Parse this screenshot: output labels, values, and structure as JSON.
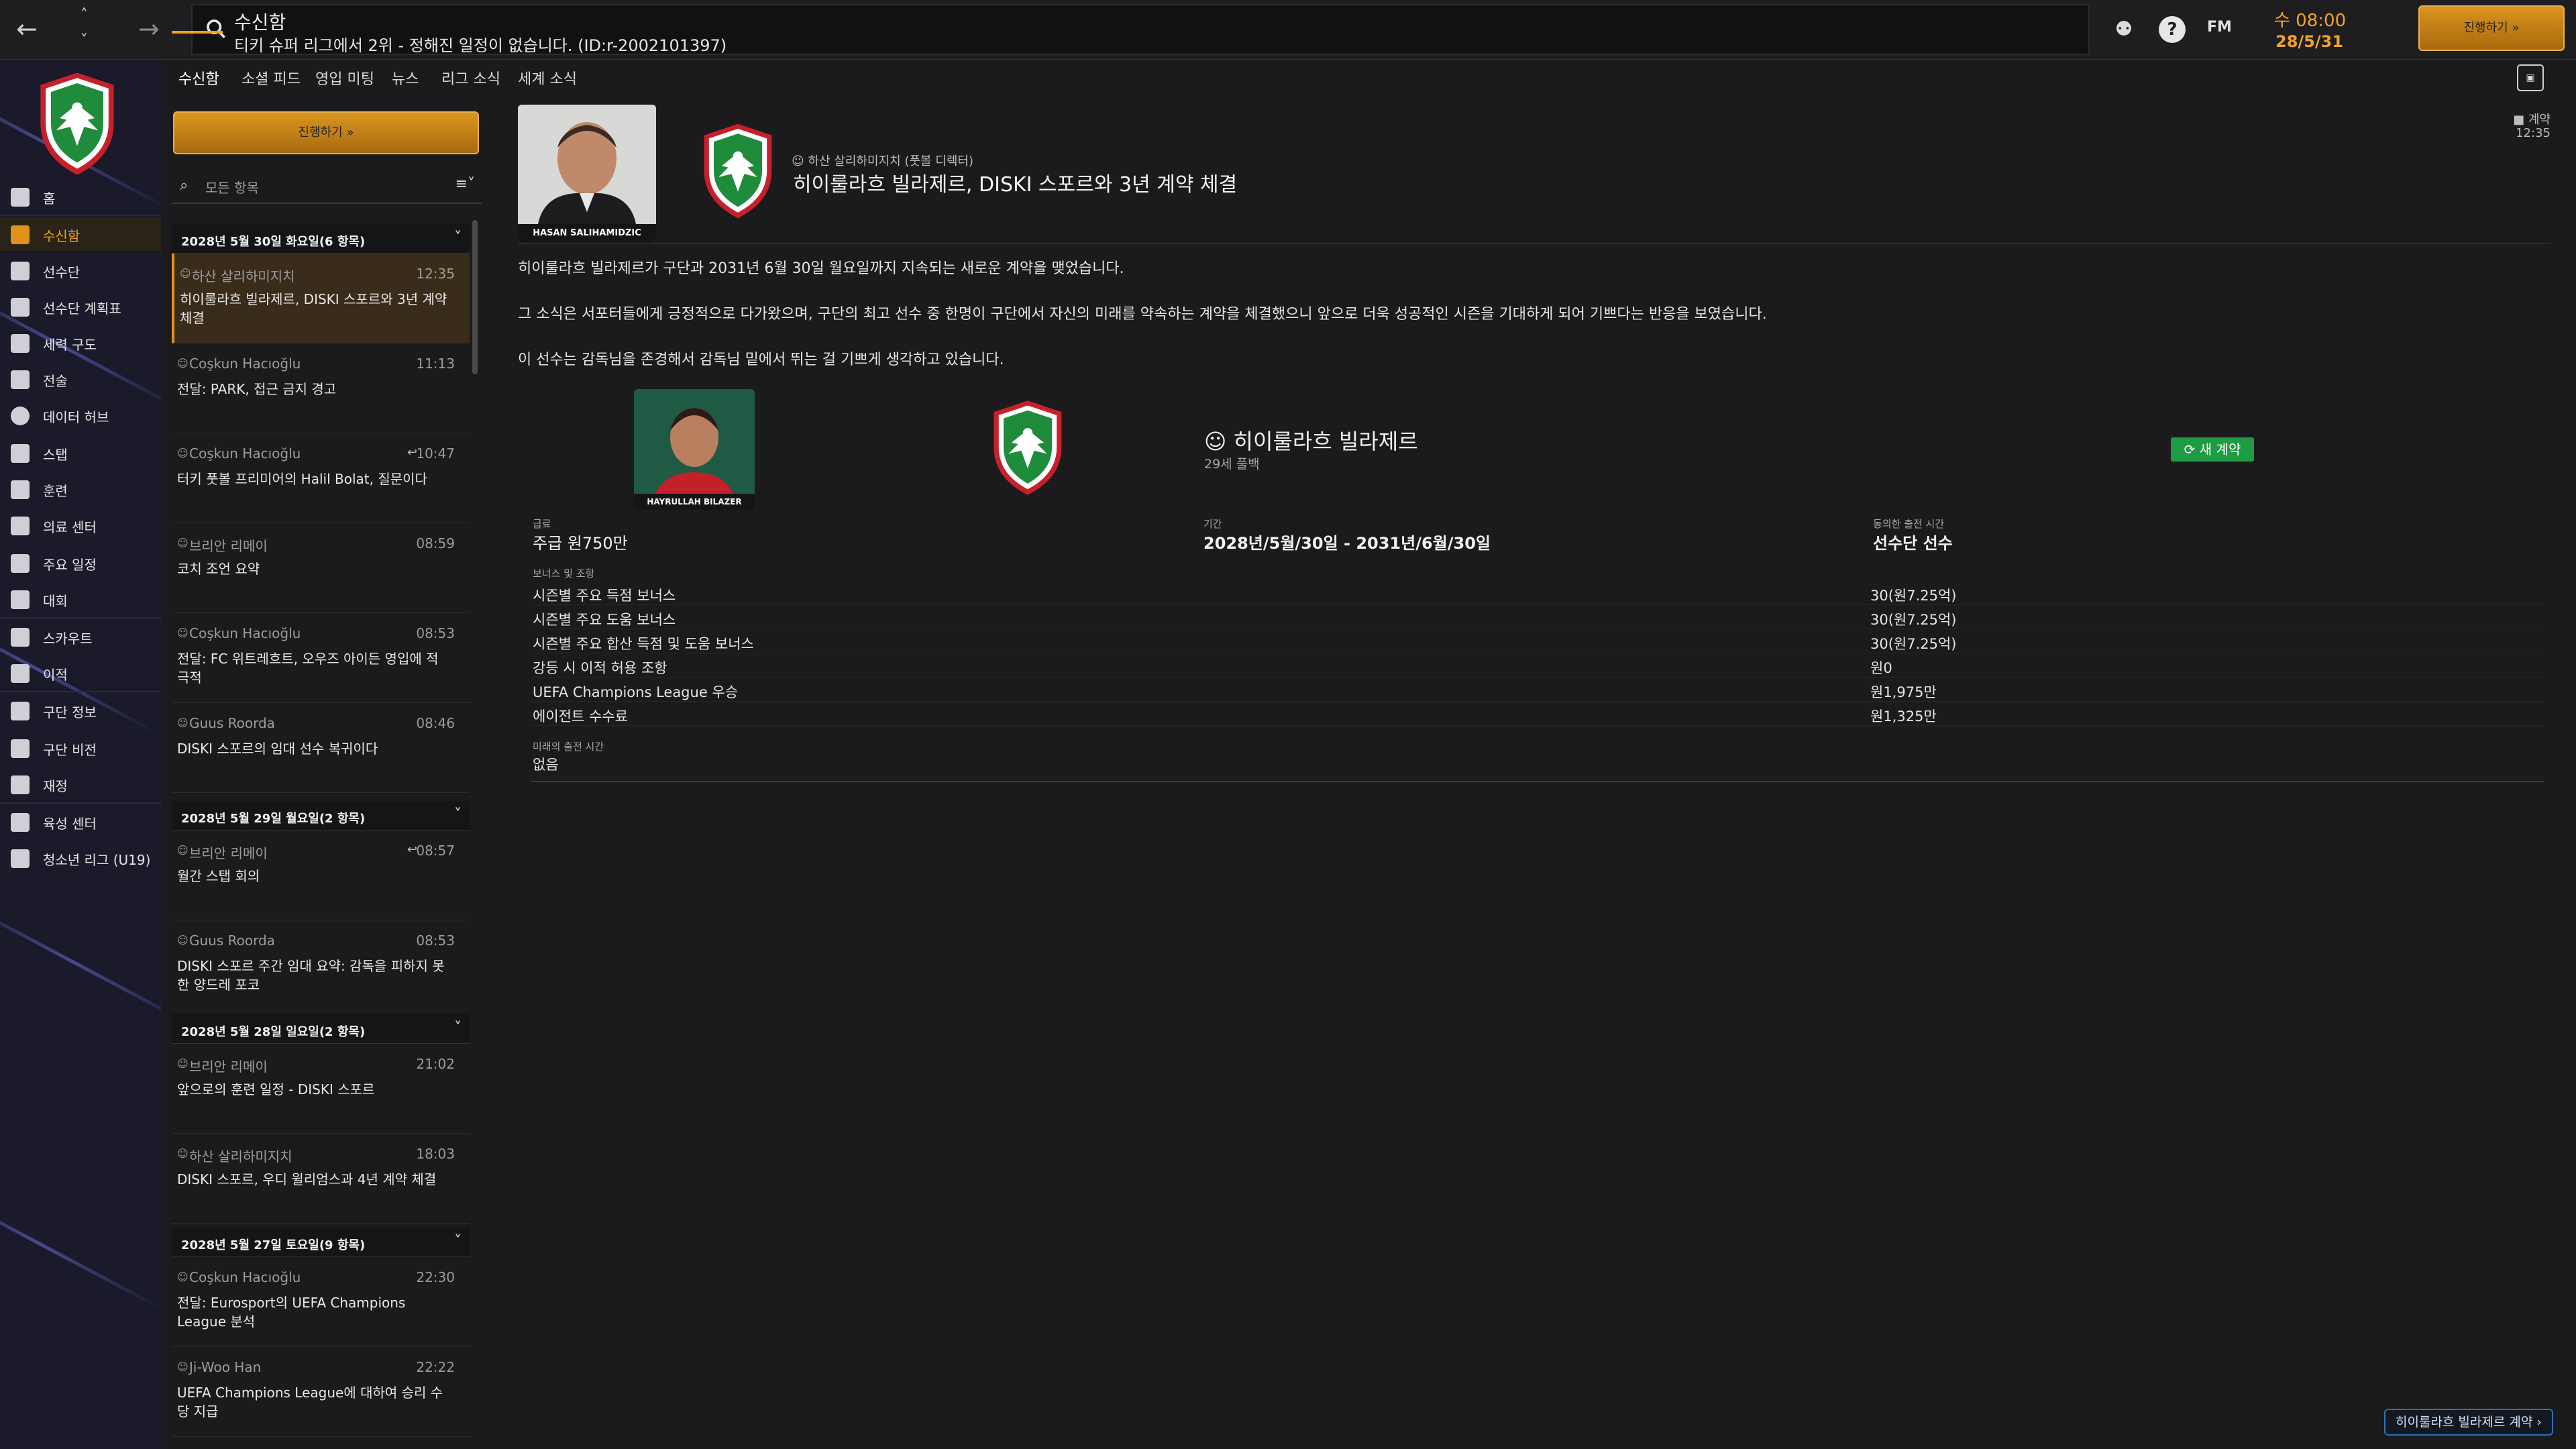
{
  "topbar": {
    "back_icon": "arrow-left-icon",
    "forward_icon": "arrow-right-icon",
    "search_title": "수신함",
    "search_subtitle": "티키 슈퍼 리그에서 2위 - 정해진 일정이 없습니다. (ID:r-2002101397)",
    "clock_day": "수 08:00",
    "clock_date": "28/5/31",
    "fm_logo": "FM",
    "continue_label": "진행하기",
    "accent_color": "#f0a020"
  },
  "sidebar": {
    "items": [
      {
        "label": "홈",
        "icon": "home-icon"
      },
      {
        "label": "수신함",
        "icon": "inbox-icon",
        "active": true
      },
      {
        "label": "선수단",
        "icon": "squad-icon"
      },
      {
        "label": "선수단 계획표",
        "icon": "planner-icon"
      },
      {
        "label": "세력 구도",
        "icon": "dynamics-icon"
      },
      {
        "label": "전술",
        "icon": "tactics-icon"
      },
      {
        "label": "데이터 허브",
        "icon": "data-hub-icon"
      },
      {
        "label": "스탭",
        "icon": "staff-icon"
      },
      {
        "label": "훈련",
        "icon": "training-icon"
      },
      {
        "label": "의료 센터",
        "icon": "medical-icon"
      },
      {
        "label": "주요 일정",
        "icon": "calendar-icon"
      },
      {
        "label": "대회",
        "icon": "trophy-icon"
      },
      {
        "label": "스카우트",
        "icon": "scouting-icon"
      },
      {
        "label": "이적",
        "icon": "transfers-icon"
      },
      {
        "label": "구단 정보",
        "icon": "club-info-icon"
      },
      {
        "label": "구단 비전",
        "icon": "club-vision-icon"
      },
      {
        "label": "재정",
        "icon": "finances-icon"
      },
      {
        "label": "육성 센터",
        "icon": "dev-centre-icon"
      },
      {
        "label": "청소년 리그 (U19)",
        "icon": "youth-icon"
      }
    ]
  },
  "subtabs": [
    "수신함",
    "소셜 피드",
    "영입 미팅",
    "뉴스",
    "리그 소식",
    "세계 소식"
  ],
  "list": {
    "continue_label": "진행하기",
    "filter_placeholder": "모든 항목",
    "groups": [
      {
        "header": "2028년 5월 30일 화요일(6 항목)",
        "messages": [
          {
            "sender": "하산 살리하미지치",
            "time": "12:35",
            "subject": "히이룰라흐 빌라제르, DISKI 스포르와 3년 계약 체결",
            "selected": true
          },
          {
            "sender": "Coşkun Hacıoğlu",
            "time": "11:13",
            "subject": "전달: PARK, 접근 금지 경고"
          },
          {
            "sender": "Coşkun Hacıoğlu",
            "time": "10:47",
            "subject": "터키 풋볼 프리미어의 Halil Bolat, 질문이다",
            "reply": true
          },
          {
            "sender": "브리안 리메이",
            "time": "08:59",
            "subject": "코치 조언 요약"
          },
          {
            "sender": "Coşkun Hacıoğlu",
            "time": "08:53",
            "subject": "전달: FC 위트레흐트, 오우즈 아이든 영입에 적극적"
          },
          {
            "sender": "Guus Roorda",
            "time": "08:46",
            "subject": "DISKI 스포르의 임대 선수 복귀이다"
          }
        ]
      },
      {
        "header": "2028년 5월 29일 월요일(2 항목)",
        "messages": [
          {
            "sender": "브리안 리메이",
            "time": "08:57",
            "subject": "월간 스탭 회의",
            "reply": true
          },
          {
            "sender": "Guus Roorda",
            "time": "08:53",
            "subject": "DISKI 스포르 주간 임대 요약: 감독을 피하지 못한 양드레 포코"
          }
        ]
      },
      {
        "header": "2028년 5월 28일 일요일(2 항목)",
        "messages": [
          {
            "sender": "브리안 리메이",
            "time": "21:02",
            "subject": "앞으로의 훈련 일정 - DISKI 스포르"
          },
          {
            "sender": "하산 살리하미지치",
            "time": "18:03",
            "subject": "DISKI 스포르, 우디 윌리엄스과 4년 계약 체결"
          }
        ]
      },
      {
        "header": "2028년 5월 27일 토요일(9 항목)",
        "messages": [
          {
            "sender": "Coşkun Hacıoğlu",
            "time": "22:30",
            "subject": "전달: Eurosport의 UEFA Champions League 분석"
          },
          {
            "sender": "Ji-Woo Han",
            "time": "22:22",
            "subject": "UEFA Champions League에 대하여 승리 수당 지급"
          }
        ]
      }
    ]
  },
  "detail": {
    "photo_caption": "HASAN SALIHAMIDZIC",
    "sender": "하산 살리하미지치 (풋볼 디렉터)",
    "title": "히이룰라흐 빌라제르, DISKI 스포르와 3년 계약 체결",
    "type": "계약",
    "time": "12:35",
    "paragraphs": [
      "히이룰라흐 빌라제르가 구단과 2031년 6월 30일 월요일까지 지속되는 새로운 계약을 맺었습니다.",
      "그 소식은 서포터들에게 긍정적으로 다가왔으며, 구단의 최고 선수 중 한명이 구단에서 자신의 미래를 약속하는 계약을 체결했으니 앞으로 더욱 성공적인 시즌을 기대하게 되어 기쁘다는 반응을 보였습니다.",
      "이 선수는 감독님을 존경해서 감독님 밑에서 뛰는 걸 기쁘게 생각하고 있습니다."
    ],
    "contract": {
      "player_caption": "HAYRULLAH BILAZER",
      "player_name": "히이룰라흐 빌라제르",
      "player_age": "29세 풀백",
      "badge": "새 계약",
      "wage_label": "급료",
      "wage_value": "주급 원750만",
      "term_label": "기간",
      "term_value": "2028년/5월/30일 - 2031년/6월/30일",
      "role_label": "동의한 출전 시간",
      "role_value": "선수단 선수",
      "bonus_label": "보너스 및 조항",
      "bonuses": [
        {
          "name": "시즌별 주요 득점 보너스",
          "value": "30(원7.25억)"
        },
        {
          "name": "시즌별 주요 도움 보너스",
          "value": "30(원7.25억)"
        },
        {
          "name": "시즌별 주요 합산 득점 및 도움 보너스",
          "value": "30(원7.25억)"
        },
        {
          "name": "강등 시 이적 허용 조항",
          "value": "원0"
        },
        {
          "name": "UEFA Champions League 우승",
          "value": "원1,975만"
        },
        {
          "name": "에이전트 수수료",
          "value": "원1,325만"
        }
      ],
      "future_label": "미래의 출전 시간",
      "future_value": "없음"
    },
    "footer_link": "히이룰라흐 빌라제르 계약"
  }
}
